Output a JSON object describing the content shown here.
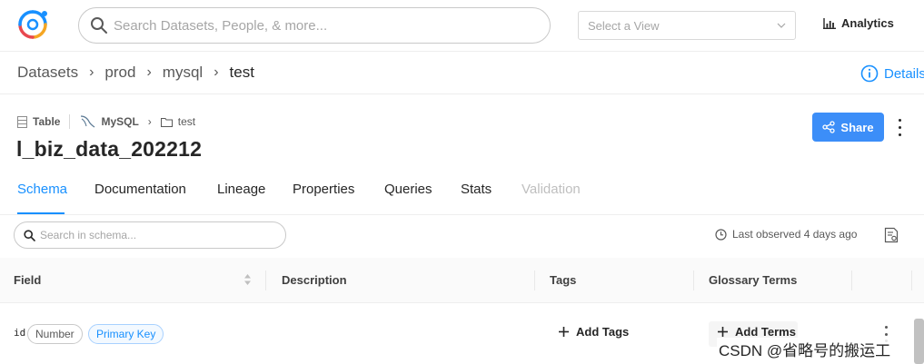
{
  "app": {
    "search_placeholder": "Search Datasets, People, & more...",
    "view_select_placeholder": "Select a View",
    "analytics_label": "Analytics",
    "accent_color": "#1890ff"
  },
  "breadcrumb": {
    "items": [
      "Datasets",
      "prod",
      "mysql",
      "test"
    ],
    "details_label": "Details"
  },
  "entity": {
    "type_label": "Table",
    "platform_label": "MySQL",
    "container_label": "test",
    "title": "l_biz_data_202212",
    "share_label": "Share"
  },
  "tabs": [
    {
      "label": "Schema",
      "state": "active"
    },
    {
      "label": "Documentation",
      "state": "normal"
    },
    {
      "label": "Lineage",
      "state": "normal"
    },
    {
      "label": "Properties",
      "state": "normal"
    },
    {
      "label": "Queries",
      "state": "normal"
    },
    {
      "label": "Stats",
      "state": "normal"
    },
    {
      "label": "Validation",
      "state": "disabled"
    }
  ],
  "schema": {
    "search_placeholder": "Search in schema...",
    "last_observed": "Last observed 4 days ago",
    "columns": [
      "Field",
      "Description",
      "Tags",
      "Glossary Terms"
    ],
    "rows": [
      {
        "field": "id",
        "type": "Number",
        "badge": "Primary Key",
        "add_tags_label": "Add Tags",
        "add_terms_label": "Add Terms"
      }
    ]
  },
  "watermark": "CSDN @省略号的搬运工"
}
